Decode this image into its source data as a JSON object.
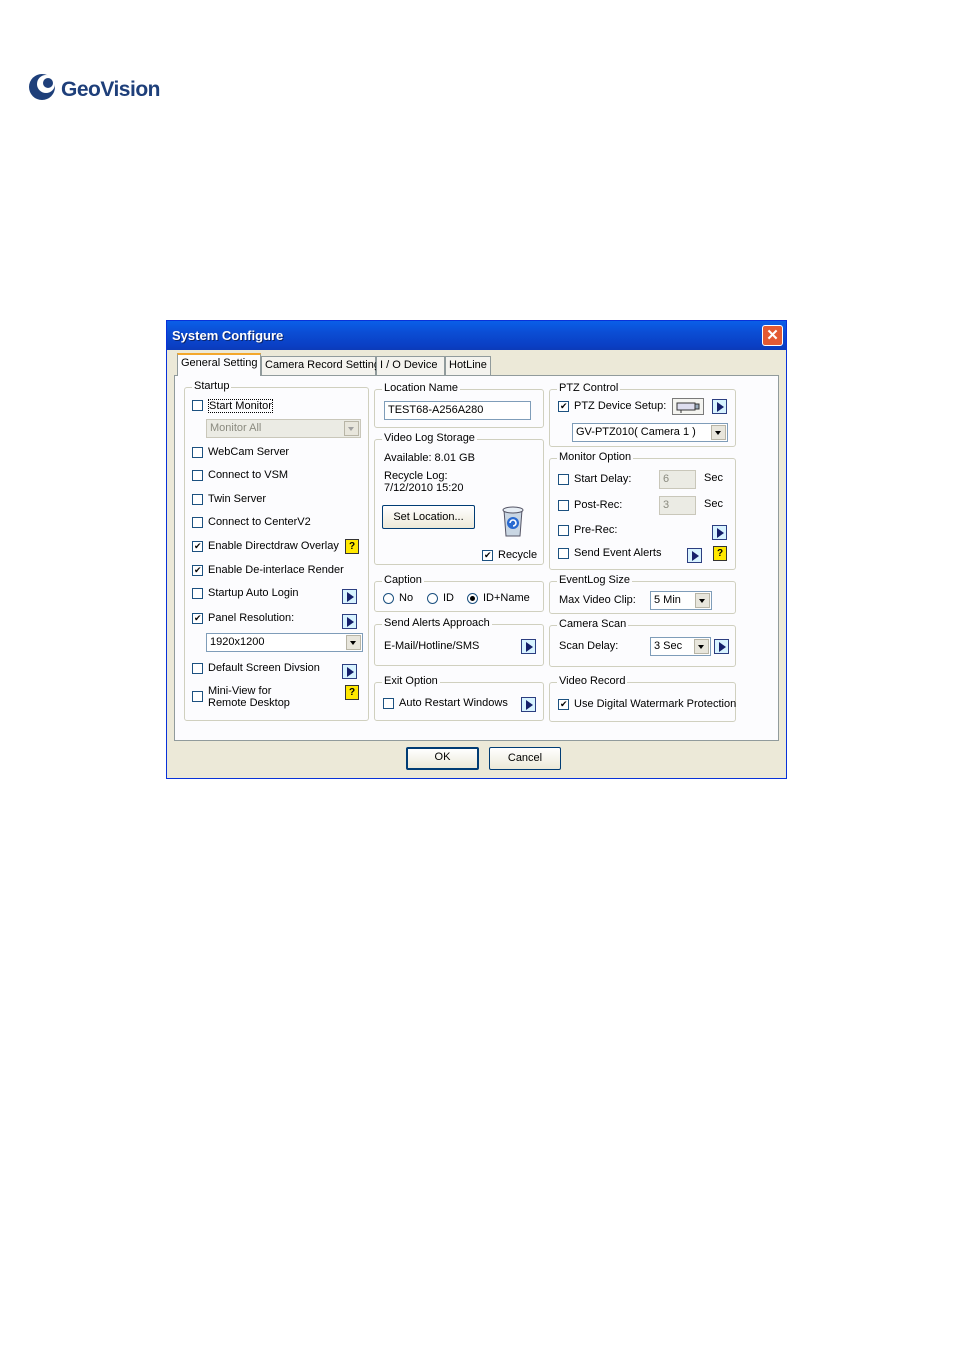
{
  "logo": {
    "text": "GeoVision"
  },
  "window": {
    "title": "System Configure",
    "close_label": "✕"
  },
  "tabs": [
    "General Setting",
    "Camera Record Setting",
    "I / O Device",
    "HotLine"
  ],
  "startup": {
    "title": "Startup",
    "start_monitor": {
      "label": "Start Monitor",
      "checked": false
    },
    "monitor_select": "Monitor All",
    "webcam_server": {
      "label": "WebCam Server",
      "checked": false
    },
    "connect_vsm": {
      "label": "Connect to VSM",
      "checked": false
    },
    "twin_server": {
      "label": "Twin Server",
      "checked": false
    },
    "connect_centerv2": {
      "label": "Connect to CenterV2",
      "checked": false
    },
    "enable_directdraw": {
      "label": "Enable Directdraw Overlay",
      "checked": true
    },
    "enable_deinterlace": {
      "label": "Enable De-interlace Render",
      "checked": true
    },
    "startup_auto_login": {
      "label": "Startup Auto Login",
      "checked": false
    },
    "panel_resolution": {
      "label": "Panel Resolution:",
      "checked": true
    },
    "resolution_value": "1920x1200",
    "default_screen_division": {
      "label": "Default Screen Divsion",
      "checked": false
    },
    "mini_view_line1": "Mini-View for",
    "mini_view_line2": "Remote Desktop"
  },
  "location_name": {
    "title": "Location Name",
    "value": "TEST68-A256A280"
  },
  "video_log_storage": {
    "title": "Video Log Storage",
    "available": "Available: 8.01 GB",
    "recycle_log_label": "Recycle Log:",
    "recycle_log_value": "7/12/2010 15:20",
    "set_location_button": "Set Location...",
    "recycle_label": "Recycle",
    "recycle_checked": true
  },
  "caption": {
    "title": "Caption",
    "options": [
      "No",
      "ID",
      "ID+Name"
    ],
    "selected": "ID+Name"
  },
  "send_alerts": {
    "title": "Send Alerts Approach",
    "value": "E-Mail/Hotline/SMS"
  },
  "exit_option": {
    "title": "Exit Option",
    "auto_restart": "Auto Restart Windows"
  },
  "ptz_control": {
    "title": "PTZ Control",
    "device_setup_label": "PTZ Device Setup:",
    "device_setup_checked": true,
    "device_select": "GV-PTZ010( Camera 1 )"
  },
  "monitor_option": {
    "title": "Monitor Option",
    "start_delay": "Start Delay:",
    "start_delay_value": "6",
    "post_rec": "Post-Rec:",
    "post_rec_value": "3",
    "sec_unit": "Sec",
    "pre_rec": "Pre-Rec:",
    "send_event_alerts": "Send Event Alerts"
  },
  "eventlog_size": {
    "title": "EventLog Size",
    "label": "Max Video Clip:",
    "value": "5 Min"
  },
  "camera_scan": {
    "title": "Camera Scan",
    "label": "Scan Delay:",
    "value": "3 Sec"
  },
  "video_record": {
    "title": "Video Record",
    "watermark_label": "Use Digital Watermark Protection",
    "watermark_checked": true
  },
  "footer": {
    "ok": "OK",
    "cancel": "Cancel"
  },
  "colors": {
    "title_bar": "#0a5fe8",
    "dialog_bg": "#ece9d8",
    "close_btn": "#e35a33",
    "help_icon": "#ffe800"
  }
}
